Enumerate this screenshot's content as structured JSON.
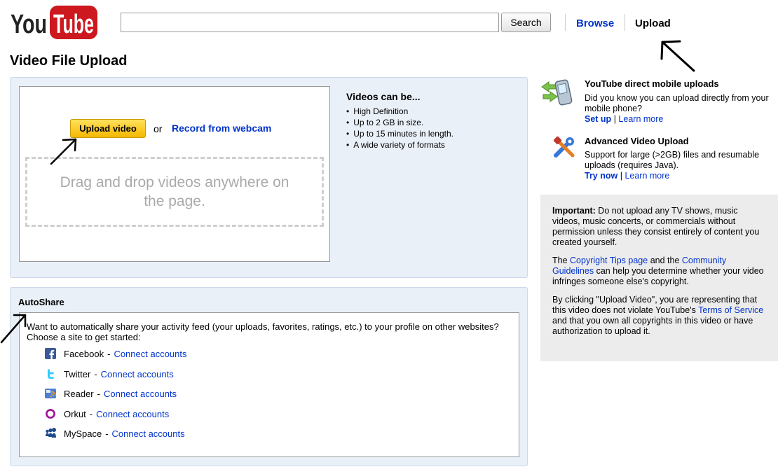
{
  "header": {
    "logo_text": "YouTube",
    "search": {
      "value": "",
      "placeholder": "",
      "button_label": "Search"
    },
    "nav": {
      "browse": "Browse",
      "upload": "Upload"
    }
  },
  "page_title": "Video File Upload",
  "upload": {
    "button_label": "Upload video",
    "or_text": "or",
    "webcam_label": "Record from webcam",
    "dropzone_text": "Drag and drop videos anywhere on the page."
  },
  "videos_can_be": {
    "title": "Videos can be...",
    "items": [
      "High Definition",
      "Up to 2 GB in size.",
      "Up to 15 minutes in length.",
      "A wide variety of formats"
    ]
  },
  "autoshare": {
    "title": "AutoShare",
    "intro": "Want to automatically share your activity feed (your uploads, favorites, ratings, etc.) to your profile on other websites? Choose a site to get started:",
    "dash": "-",
    "sites": [
      {
        "name": "Facebook",
        "action": "Connect accounts",
        "icon": "facebook-icon",
        "color": "#3b5998"
      },
      {
        "name": "Twitter",
        "action": "Connect accounts",
        "icon": "twitter-icon",
        "color": "#33ccff"
      },
      {
        "name": "Reader",
        "action": "Connect accounts",
        "icon": "reader-icon",
        "color": "#4a7fd4"
      },
      {
        "name": "Orkut",
        "action": "Connect accounts",
        "icon": "orkut-icon",
        "color": "#a0109a"
      },
      {
        "name": "MySpace",
        "action": "Connect accounts",
        "icon": "myspace-icon",
        "color": "#1d4a8c"
      }
    ]
  },
  "sidebar": {
    "mobile": {
      "title": "YouTube direct mobile uploads",
      "text": "Did you know you can upload directly from your mobile phone?",
      "link1": "Set up",
      "sep": "|",
      "link2": "Learn more"
    },
    "advanced": {
      "title": "Advanced Video Upload",
      "text": "Support for large (>2GB) files and resumable uploads (requires Java).",
      "link1": "Try now",
      "sep": "|",
      "link2": "Learn more"
    },
    "important": {
      "label": "Important:",
      "p1": "Do not upload any TV shows, music videos, music concerts, or commercials without permission unless they consist entirely of content you created yourself.",
      "p2_a": "The",
      "p2_link1": "Copyright Tips page",
      "p2_b": "and the",
      "p2_link2": "Community Guidelines",
      "p2_c": "can help you determine whether your video infringes someone else's copyright.",
      "p3_a": "By clicking \"Upload Video\", you are representing that this video does not violate YouTube's",
      "p3_link": "Terms of Service",
      "p3_b": "and that you own all copyrights in this video or have authorization to upload it."
    }
  },
  "colors": {
    "brand_red": "#cc181e",
    "link_blue": "#0033cc",
    "upload_button": "#fcd33a",
    "panel_bg": "#eaf0f8",
    "important_bg": "#ececec"
  }
}
